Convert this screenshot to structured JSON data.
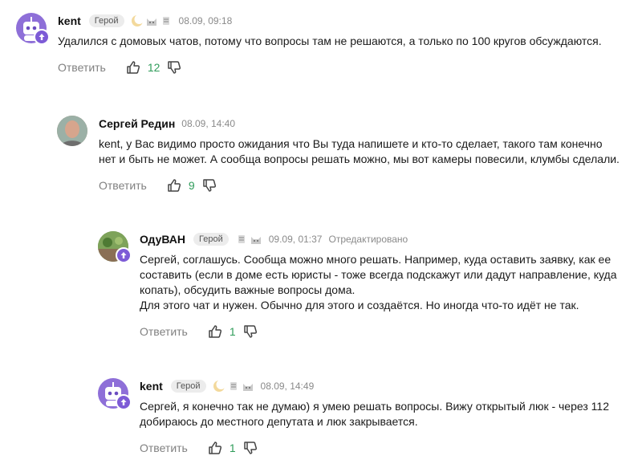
{
  "comments": [
    {
      "author": "kent",
      "role": "Герой",
      "date": "08.09, 09:18",
      "edited": "",
      "text": "Удалился с домовых чатов, потому что вопросы там не решаются, а только по 100 кругов обсуждаются.",
      "reply_label": "Ответить",
      "likes": "12",
      "avatar": "purple-robot-avatar"
    },
    {
      "author": "Сергей Редин",
      "role": "",
      "date": "08.09, 14:40",
      "edited": "",
      "text": "kent, у Вас видимо просто ожидания что Вы туда напишете и кто-то сделает, такого там конечно нет и быть не может. А сообща вопросы решать можно, мы вот камеры повесили, клумбы сделали.",
      "reply_label": "Ответить",
      "likes": "9",
      "avatar": "photo-avatar"
    },
    {
      "author": "ОдуВАН",
      "role": "Герой",
      "date": "09.09, 01:37",
      "edited": "Отредактировано",
      "text": "Сергей, соглашусь. Сообща можно много решать. Например, куда оставить заявку, как ее составить (если в доме есть юристы - тоже всегда подскажут или дадут направление, куда копать), обсудить важные вопросы дома.\nДля этого чат и нужен. Обычно для этого и создаётся. Но иногда что-то идёт не так.",
      "reply_label": "Ответить",
      "likes": "1",
      "avatar": "garden-photo-avatar"
    },
    {
      "author": "kent",
      "role": "Герой",
      "date": "08.09, 14:49",
      "edited": "",
      "text": "Сергей, я конечно так не думаю) я умею решать вопросы. Вижу открытый люк - через 112 добираюсь до местного депутата и люк закрывается.",
      "reply_label": "Ответить",
      "likes": "1",
      "avatar": "purple-robot-avatar"
    }
  ],
  "colors": {
    "like_count": "#2f9c5a",
    "muted": "#808080",
    "badge_purple": "#7d5bd6"
  }
}
